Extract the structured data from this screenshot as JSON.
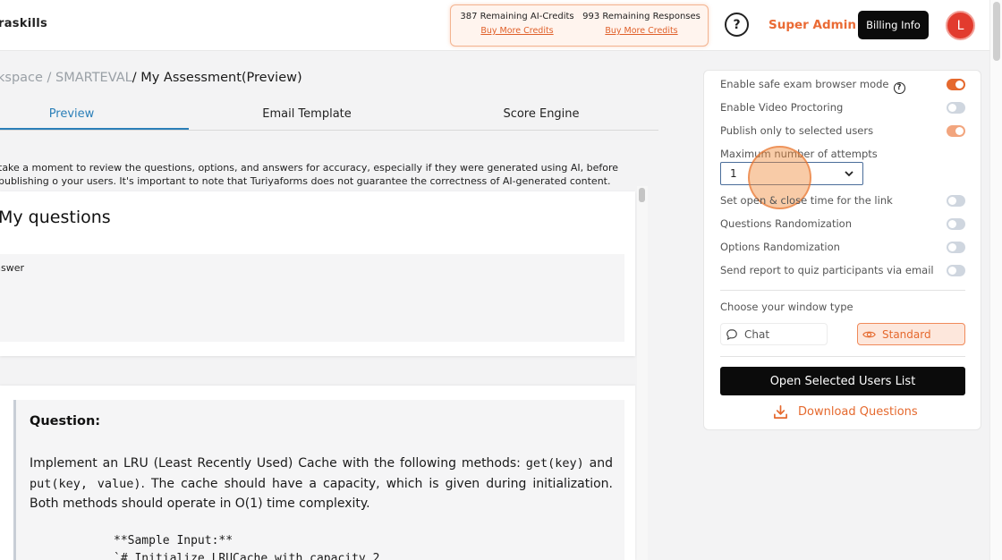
{
  "header": {
    "brand": "raskills",
    "credits": {
      "ai_credits": "387 Remaining AI-Credits",
      "ai_credits_link": "Buy More Credits",
      "responses": "993 Remaining Responses",
      "responses_link": "Buy More Credits"
    },
    "help_glyph": "?",
    "role": "Super Admin",
    "billing_label": "Billing Info",
    "avatar_initial": "L"
  },
  "breadcrumb": {
    "muted": "kspace / SMARTEVAL",
    "current": "/ My Assessment(Preview)"
  },
  "tabs": [
    {
      "label": "Preview",
      "active": true
    },
    {
      "label": "Email Template",
      "active": false
    },
    {
      "label": "Score Engine",
      "active": false
    }
  ],
  "notice": "take a moment to review the questions, options, and answers for accuracy, especially if they were generated using AI, before publishing o your users. It's important to note that Turiyaforms does not guarantee the correctness of AI-generated content.",
  "questions_panel": {
    "title": "My questions",
    "answer_label": "nswer"
  },
  "question": {
    "label": "Question:",
    "text_1": "Implement an LRU (Least Recently Used) Cache with the following methods: ",
    "code_1": "get(key)",
    "text_2": " and ",
    "code_2": "put(key, value)",
    "text_3": ". The cache should have a capacity, which is given during initialization. Both methods should operate in O(1) time complexity.",
    "sample_1": "**Sample Input:**",
    "sample_2": "`# Initialize LRUCache with capacity 2"
  },
  "settings": {
    "safe_exam": {
      "label": "Enable safe exam browser mode",
      "state": "on"
    },
    "video_proctoring": {
      "label": "Enable Video Proctoring",
      "state": "off"
    },
    "publish_selected": {
      "label": "Publish only to selected users",
      "state": "on-disabled"
    },
    "max_attempts": {
      "label": "Maximum number of attempts",
      "value": "1"
    },
    "open_close_time": {
      "label": "Set open & close time for the link",
      "state": "off"
    },
    "questions_random": {
      "label": "Questions Randomization",
      "state": "off"
    },
    "options_random": {
      "label": "Options Randomization",
      "state": "off"
    },
    "send_report": {
      "label": "Send report to quiz participants via email",
      "state": "off"
    },
    "window_type_label": "Choose your window type",
    "window_types": [
      {
        "label": "Chat",
        "icon": "chat-bubble-icon",
        "selected": false
      },
      {
        "label": "Standard",
        "icon": "eye-icon",
        "selected": true
      }
    ],
    "open_users_btn": "Open Selected Users List",
    "download_label": "Download Questions"
  },
  "colors": {
    "accent": "#e5692e",
    "tab_active": "#2b7fb8",
    "button_dark": "#0b0b0b"
  }
}
